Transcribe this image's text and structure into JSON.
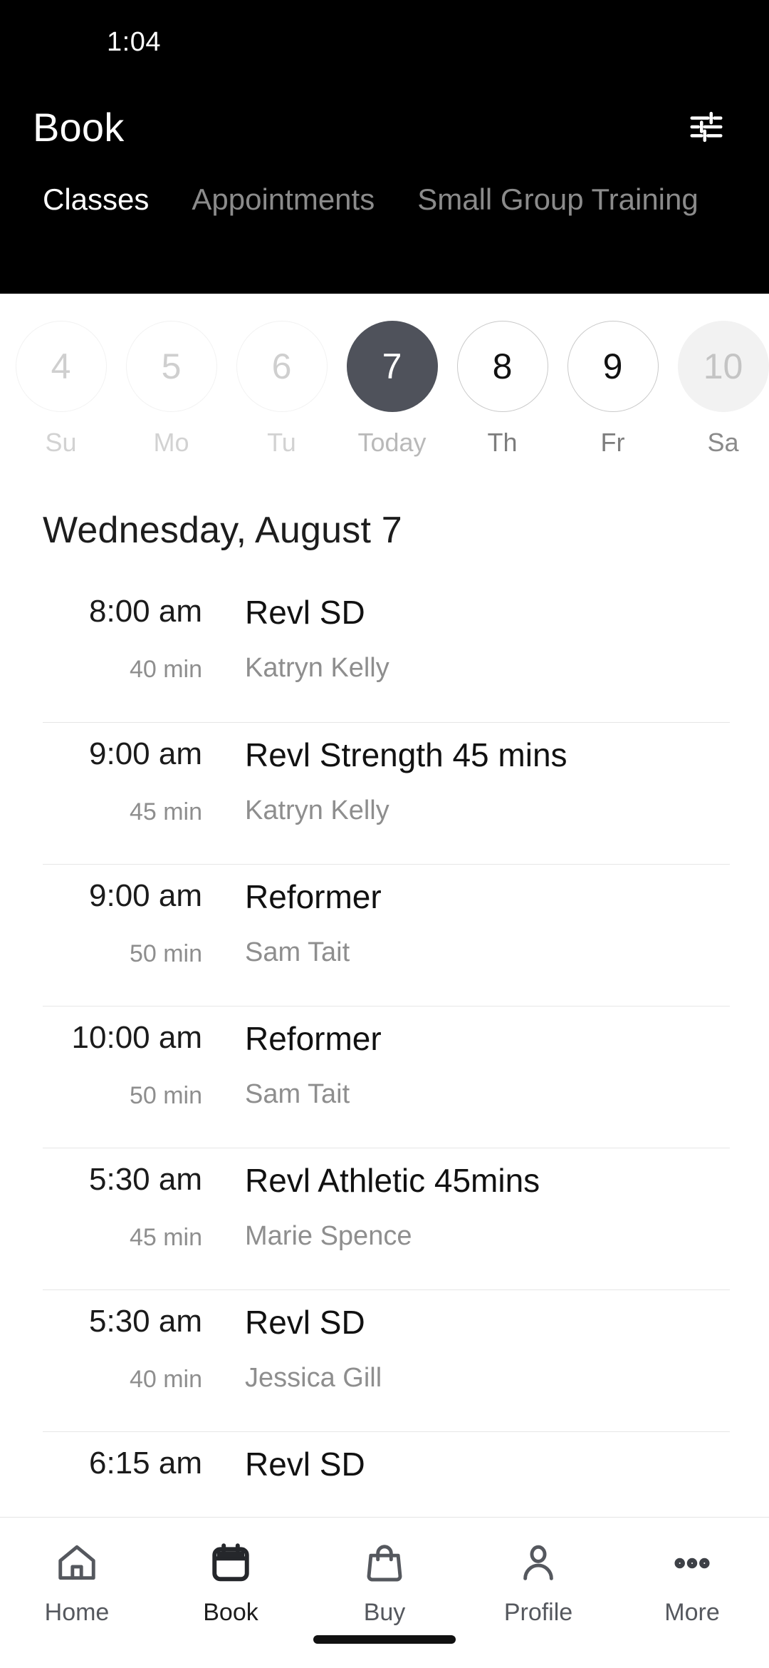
{
  "status_bar": {
    "time": "1:04"
  },
  "header": {
    "title": "Book",
    "filter_icon": "sliders-filter-icon",
    "accent_dark": "#000000",
    "selected_day_color": "#4f525b"
  },
  "tabs": [
    {
      "label": "Classes",
      "active": true
    },
    {
      "label": "Appointments",
      "active": false
    },
    {
      "label": "Small Group Training",
      "active": false
    }
  ],
  "date_strip": [
    {
      "day": "4",
      "label": "Su",
      "state": "past"
    },
    {
      "day": "5",
      "label": "Mo",
      "state": "past"
    },
    {
      "day": "6",
      "label": "Tu",
      "state": "past"
    },
    {
      "day": "7",
      "label": "Today",
      "state": "selected"
    },
    {
      "day": "8",
      "label": "Th",
      "state": "normal"
    },
    {
      "day": "9",
      "label": "Fr",
      "state": "normal"
    },
    {
      "day": "10",
      "label": "Sa",
      "state": "muted"
    }
  ],
  "main": {
    "date_heading": "Wednesday, August 7",
    "classes": [
      {
        "time": "8:00 am",
        "duration": "40 min",
        "name": "Revl SD",
        "coach": "Katryn Kelly"
      },
      {
        "time": "9:00 am",
        "duration": "45 min",
        "name": "Revl Strength 45 mins",
        "coach": "Katryn Kelly"
      },
      {
        "time": "9:00 am",
        "duration": "50 min",
        "name": "Reformer",
        "coach": "Sam Tait"
      },
      {
        "time": "10:00 am",
        "duration": "50 min",
        "name": "Reformer",
        "coach": "Sam Tait"
      },
      {
        "time": "5:30 am",
        "duration": "45 min",
        "name": "Revl Athletic 45mins",
        "coach": "Marie Spence"
      },
      {
        "time": "5:30 am",
        "duration": "40 min",
        "name": "Revl SD",
        "coach": "Jessica Gill"
      },
      {
        "time": "6:15 am",
        "duration": "",
        "name": "Revl SD",
        "coach": ""
      }
    ]
  },
  "bottom_nav": [
    {
      "label": "Home",
      "icon": "house-icon",
      "active": false
    },
    {
      "label": "Book",
      "icon": "calendar-icon",
      "active": true
    },
    {
      "label": "Buy",
      "icon": "shopping-bag-icon",
      "active": false
    },
    {
      "label": "Profile",
      "icon": "person-icon",
      "active": false
    },
    {
      "label": "More",
      "icon": "ellipsis-icon",
      "active": false
    }
  ]
}
